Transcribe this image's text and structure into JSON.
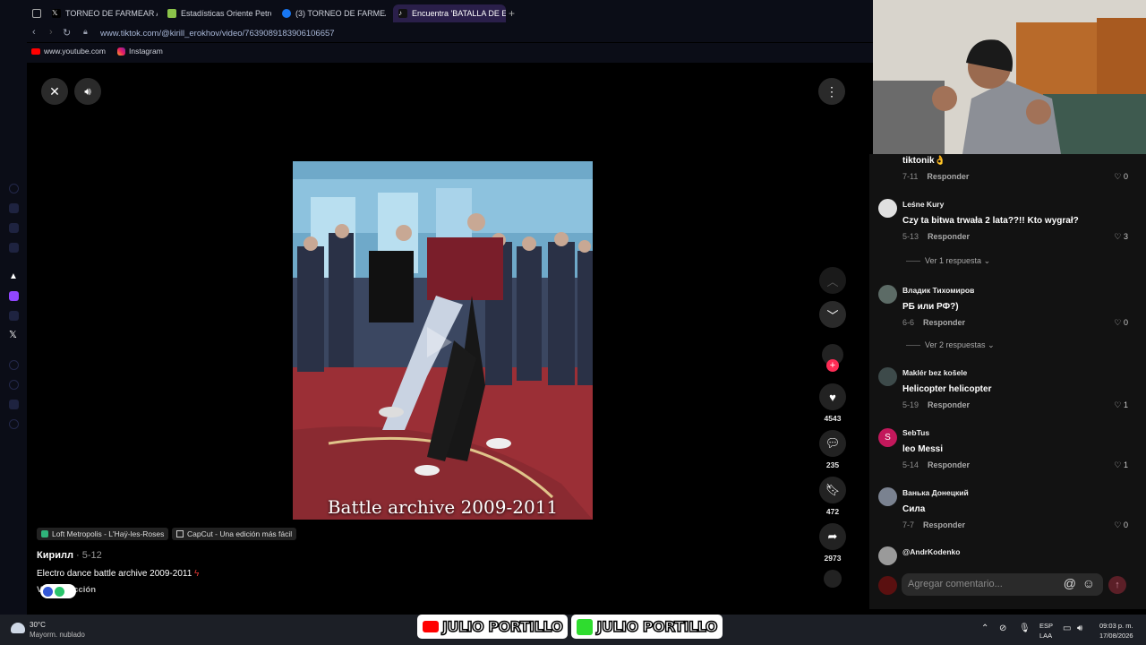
{
  "browser": {
    "tabs": [
      {
        "label": "TORNEO DE FARMEAR AUR",
        "icon": "x-icon"
      },
      {
        "label": "Estadísticas Oriente Petrole",
        "icon": "stats-icon"
      },
      {
        "label": "(3) TORNEO DE FARMEAR",
        "icon": "facebook-icon"
      },
      {
        "label": "Encuentra 'BATALLA DE EL",
        "icon": "tiktok-icon"
      }
    ],
    "url": "www.tiktok.com/@kirill_erokhov/video/7639089183906106657",
    "bookmarks": [
      "www.youtube.com",
      "Instagram"
    ]
  },
  "video": {
    "caption_overlay": "Battle archive 2009-2011",
    "likes": "4543",
    "comments": "235",
    "saves": "472",
    "shares": "2973",
    "chips": [
      "Loft Metropolis - L'Haÿ-les-Roses",
      "CapCut - Una edición más fácil"
    ],
    "author": "Кирилл",
    "date": "5-12",
    "description": "Electro dance battle archive 2009-2011",
    "translate_label": "Ver traducción"
  },
  "comments": {
    "items": [
      {
        "author": "",
        "text": "tiktonik👌",
        "date": "7-11",
        "reply": "Responder",
        "likes": "0"
      },
      {
        "author": "Leśne Kury",
        "text": "Czy ta bitwa trwała 2 lata??!! Kto wygrał?",
        "date": "5-13",
        "reply": "Responder",
        "likes": "3",
        "replies": "Ver 1 respuesta"
      },
      {
        "author": "Владик Тихомиров",
        "text": "РБ или РФ?)",
        "date": "6-6",
        "reply": "Responder",
        "likes": "0",
        "replies": "Ver 2 respuestas"
      },
      {
        "author": "Maklér bez košele",
        "text": "Helicopter helicopter",
        "date": "5-19",
        "reply": "Responder",
        "likes": "1"
      },
      {
        "author": "SebTus",
        "text": "leo Messi",
        "date": "5-14",
        "reply": "Responder",
        "likes": "1"
      },
      {
        "author": "Ванька Донецкий",
        "text": "Сила",
        "date": "7-7",
        "reply": "Responder",
        "likes": "0"
      },
      {
        "author": "@AndrKodenko",
        "text": "",
        "date": "",
        "reply": "",
        "likes": ""
      }
    ],
    "input_placeholder": "Agregar comentario..."
  },
  "taskbar": {
    "weather_temp": "30°C",
    "weather_desc": "Mayorm. nublado",
    "lang_top": "ESP",
    "lang_bottom": "LAA",
    "time": "09:03 p. m.",
    "date": "17/08/2026"
  },
  "overlay": {
    "name1": "JULIO PORTILLO",
    "name2": "JULIO PORTILLO"
  },
  "colors": {
    "accent": "#fe2c55",
    "panel": "#121212",
    "chrome": "#0b0d17"
  }
}
